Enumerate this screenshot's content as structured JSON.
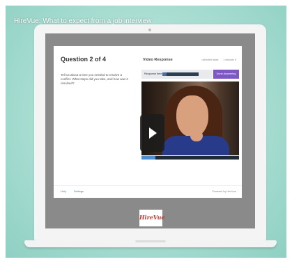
{
  "video": {
    "title": "HireVue: What to expect from a job interview"
  },
  "app": {
    "question_title": "Question 2 of 4",
    "question_text": "Tell us about a time you needed to resolve a conflict. What steps did you take, and how was it resolved?",
    "video_response_title": "Video Response",
    "meta_attempts": "unlimited takes",
    "meta_minutes": "1 minutes 8",
    "response_time_label": "Response time 0:12",
    "response_progress": 0.12,
    "done_button": "Done Answering",
    "help_link": "Help",
    "settings_link": "Settings",
    "powered_by": "Powered by HireVue"
  },
  "logo": {
    "text": "HireVue"
  },
  "colors": {
    "accent": "#7e57c2",
    "background": "#a9ddd2",
    "logo": "#c0392b"
  }
}
